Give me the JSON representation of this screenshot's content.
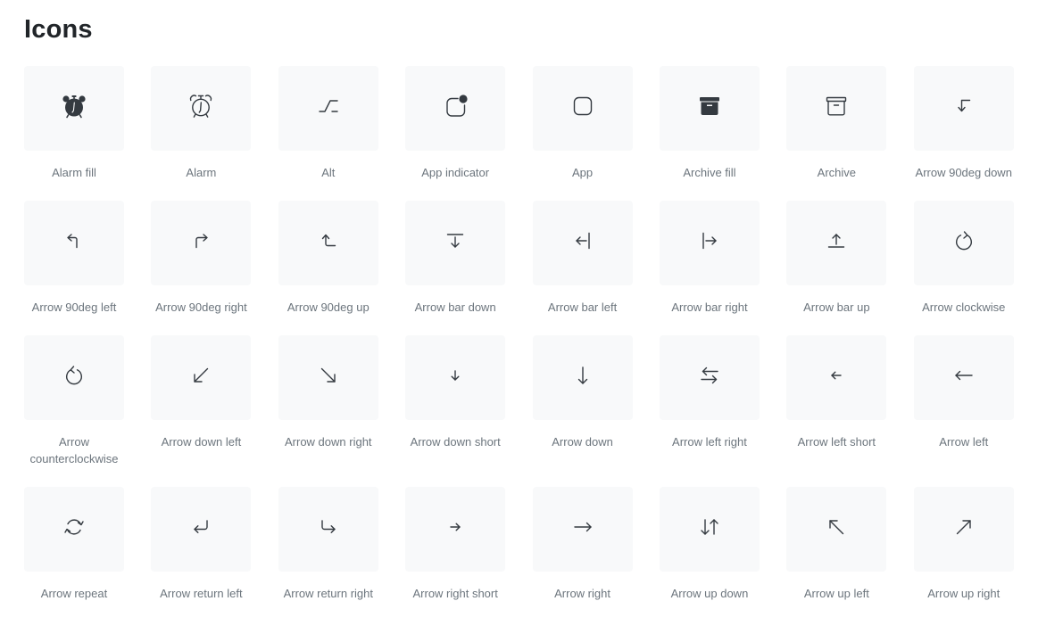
{
  "page": {
    "title": "Icons"
  },
  "icon_color": "#343a40",
  "tile_bg": "#f8f9fa",
  "label_color": "#6c757d",
  "icons": [
    {
      "name": "alarm-fill-icon",
      "label": "Alarm fill"
    },
    {
      "name": "alarm-icon",
      "label": "Alarm"
    },
    {
      "name": "alt-icon",
      "label": "Alt"
    },
    {
      "name": "app-indicator-icon",
      "label": "App indicator"
    },
    {
      "name": "app-icon",
      "label": "App"
    },
    {
      "name": "archive-fill-icon",
      "label": "Archive fill"
    },
    {
      "name": "archive-icon",
      "label": "Archive"
    },
    {
      "name": "arrow-90deg-down-icon",
      "label": "Arrow 90deg down"
    },
    {
      "name": "arrow-90deg-left-icon",
      "label": "Arrow 90deg left"
    },
    {
      "name": "arrow-90deg-right-icon",
      "label": "Arrow 90deg right"
    },
    {
      "name": "arrow-90deg-up-icon",
      "label": "Arrow 90deg up"
    },
    {
      "name": "arrow-bar-down-icon",
      "label": "Arrow bar down"
    },
    {
      "name": "arrow-bar-left-icon",
      "label": "Arrow bar left"
    },
    {
      "name": "arrow-bar-right-icon",
      "label": "Arrow bar right"
    },
    {
      "name": "arrow-bar-up-icon",
      "label": "Arrow bar up"
    },
    {
      "name": "arrow-clockwise-icon",
      "label": "Arrow clockwise"
    },
    {
      "name": "arrow-counterclockwise-icon",
      "label": "Arrow counterclockwise"
    },
    {
      "name": "arrow-down-left-icon",
      "label": "Arrow down left"
    },
    {
      "name": "arrow-down-right-icon",
      "label": "Arrow down right"
    },
    {
      "name": "arrow-down-short-icon",
      "label": "Arrow down short"
    },
    {
      "name": "arrow-down-icon",
      "label": "Arrow down"
    },
    {
      "name": "arrow-left-right-icon",
      "label": "Arrow left right"
    },
    {
      "name": "arrow-left-short-icon",
      "label": "Arrow left short"
    },
    {
      "name": "arrow-left-icon",
      "label": "Arrow left"
    },
    {
      "name": "arrow-repeat-icon",
      "label": "Arrow repeat"
    },
    {
      "name": "arrow-return-left-icon",
      "label": "Arrow return left"
    },
    {
      "name": "arrow-return-right-icon",
      "label": "Arrow return right"
    },
    {
      "name": "arrow-right-short-icon",
      "label": "Arrow right short"
    },
    {
      "name": "arrow-right-icon",
      "label": "Arrow right"
    },
    {
      "name": "arrow-up-down-icon",
      "label": "Arrow up down"
    },
    {
      "name": "arrow-up-left-icon",
      "label": "Arrow up left"
    },
    {
      "name": "arrow-up-right-icon",
      "label": "Arrow up right"
    }
  ]
}
